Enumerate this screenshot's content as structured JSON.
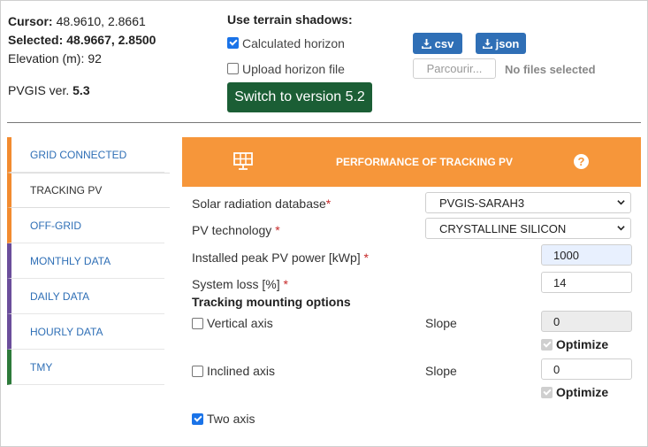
{
  "location": {
    "cursor_label": "Cursor:",
    "cursor_value": "48.9610, 2.8661",
    "selected_label": "Selected:",
    "selected_value": "48.9667, 2.8500",
    "elevation_label": "Elevation (m):",
    "elevation_value": "92",
    "version_label": "PVGIS ver.",
    "version_value": "5.3"
  },
  "terrain": {
    "title": "Use terrain shadows:",
    "calculated_label": "Calculated horizon",
    "calculated_checked": true,
    "upload_label": "Upload horizon file",
    "upload_checked": false
  },
  "switch_button": "Switch to version 5.2",
  "downloads": {
    "csv_label": "csv",
    "json_label": "json"
  },
  "file_upload": {
    "browse_label": "Parcourir...",
    "status": "No files selected"
  },
  "tabs": [
    {
      "label": "GRID CONNECTED",
      "color": "#f28b30",
      "active": false
    },
    {
      "label": "TRACKING PV",
      "color": "#f28b30",
      "active": true
    },
    {
      "label": "OFF-GRID",
      "color": "#f28b30",
      "active": false
    },
    {
      "label": "MONTHLY DATA",
      "color": "#6b4e9b",
      "active": false
    },
    {
      "label": "DAILY DATA",
      "color": "#6b4e9b",
      "active": false
    },
    {
      "label": "HOURLY DATA",
      "color": "#6b4e9b",
      "active": false
    },
    {
      "label": "TMY",
      "color": "#2d7a3a",
      "active": false
    }
  ],
  "panel": {
    "title": "PERFORMANCE OF TRACKING PV",
    "header_color": "#f6963a",
    "icon": "solar-panel-icon",
    "help_icon": "?",
    "radiation_db_label": "Solar radiation database",
    "radiation_db_value": "PVGIS-SARAH3",
    "pv_tech_label": "PV technology",
    "pv_tech_value": "CRYSTALLINE SILICON",
    "peak_power_label": "Installed peak PV power [kWp]",
    "peak_power_value": "1000",
    "system_loss_label": "System loss [%]",
    "system_loss_value": "14",
    "required_mark": "*",
    "tracking_title": "Tracking mounting options",
    "vertical_axis_label": "Vertical axis",
    "vertical_axis_checked": false,
    "vertical_slope_label": "Slope",
    "vertical_slope_value": "0",
    "vertical_optimize_label": "Optimize",
    "inclined_axis_label": "Inclined axis",
    "inclined_axis_checked": false,
    "inclined_slope_label": "Slope",
    "inclined_slope_value": "0",
    "inclined_optimize_label": "Optimize",
    "two_axis_label": "Two axis",
    "two_axis_checked": true
  }
}
